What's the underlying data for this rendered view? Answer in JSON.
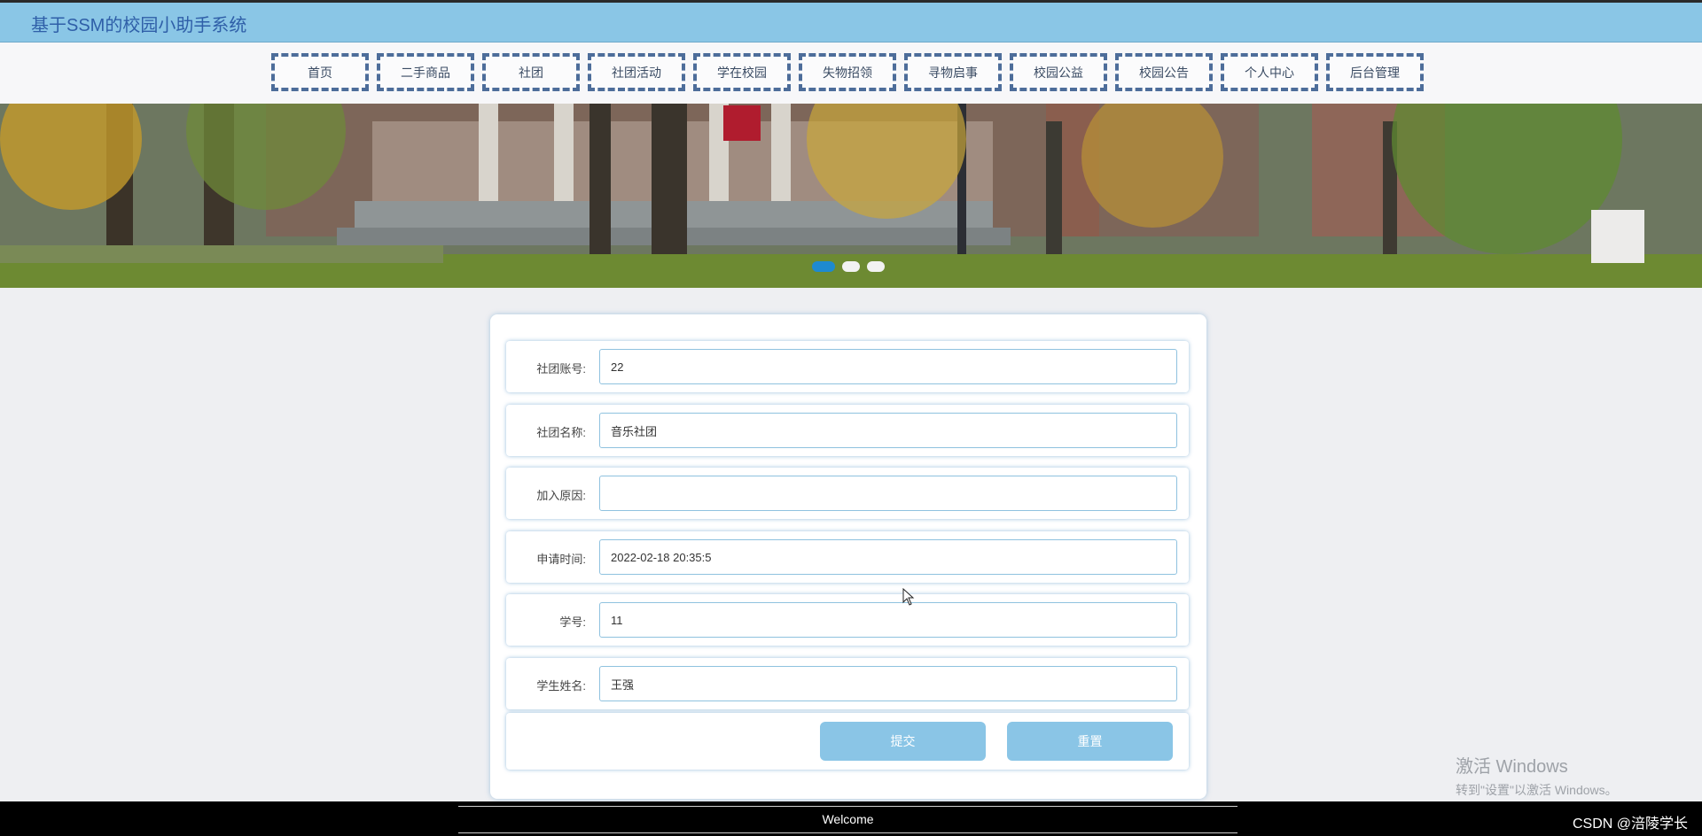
{
  "header": {
    "title": "基于SSM的校园小助手系统"
  },
  "nav": {
    "items": [
      "首页",
      "二手商品",
      "社团",
      "社团活动",
      "学在校园",
      "失物招领",
      "寻物启事",
      "校园公益",
      "校园公告",
      "个人中心",
      "后台管理"
    ]
  },
  "banner": {
    "slide_count": 3,
    "active_slide": 1
  },
  "form": {
    "fields": [
      {
        "label": "社团账号:",
        "value": "22"
      },
      {
        "label": "社团名称:",
        "value": "音乐社团"
      },
      {
        "label": "加入原因:",
        "value": ""
      },
      {
        "label": "申请时间:",
        "value": "2022-02-18 20:35:5"
      },
      {
        "label": "学号:",
        "value": "11"
      },
      {
        "label": "学生姓名:",
        "value": "王强"
      }
    ],
    "submit_label": "提交",
    "reset_label": "重置"
  },
  "footer": {
    "welcome": "Welcome",
    "credit": "CSDN @涪陵学长"
  },
  "watermark": {
    "line1": "激活 Windows",
    "line2": "转到\"设置\"以激活 Windows。"
  },
  "colors": {
    "header_bg": "#8ac6e6",
    "nav_border": "#4d6d9a",
    "button_bg": "#8ac5e6",
    "dot_active": "#1e8ad0"
  }
}
